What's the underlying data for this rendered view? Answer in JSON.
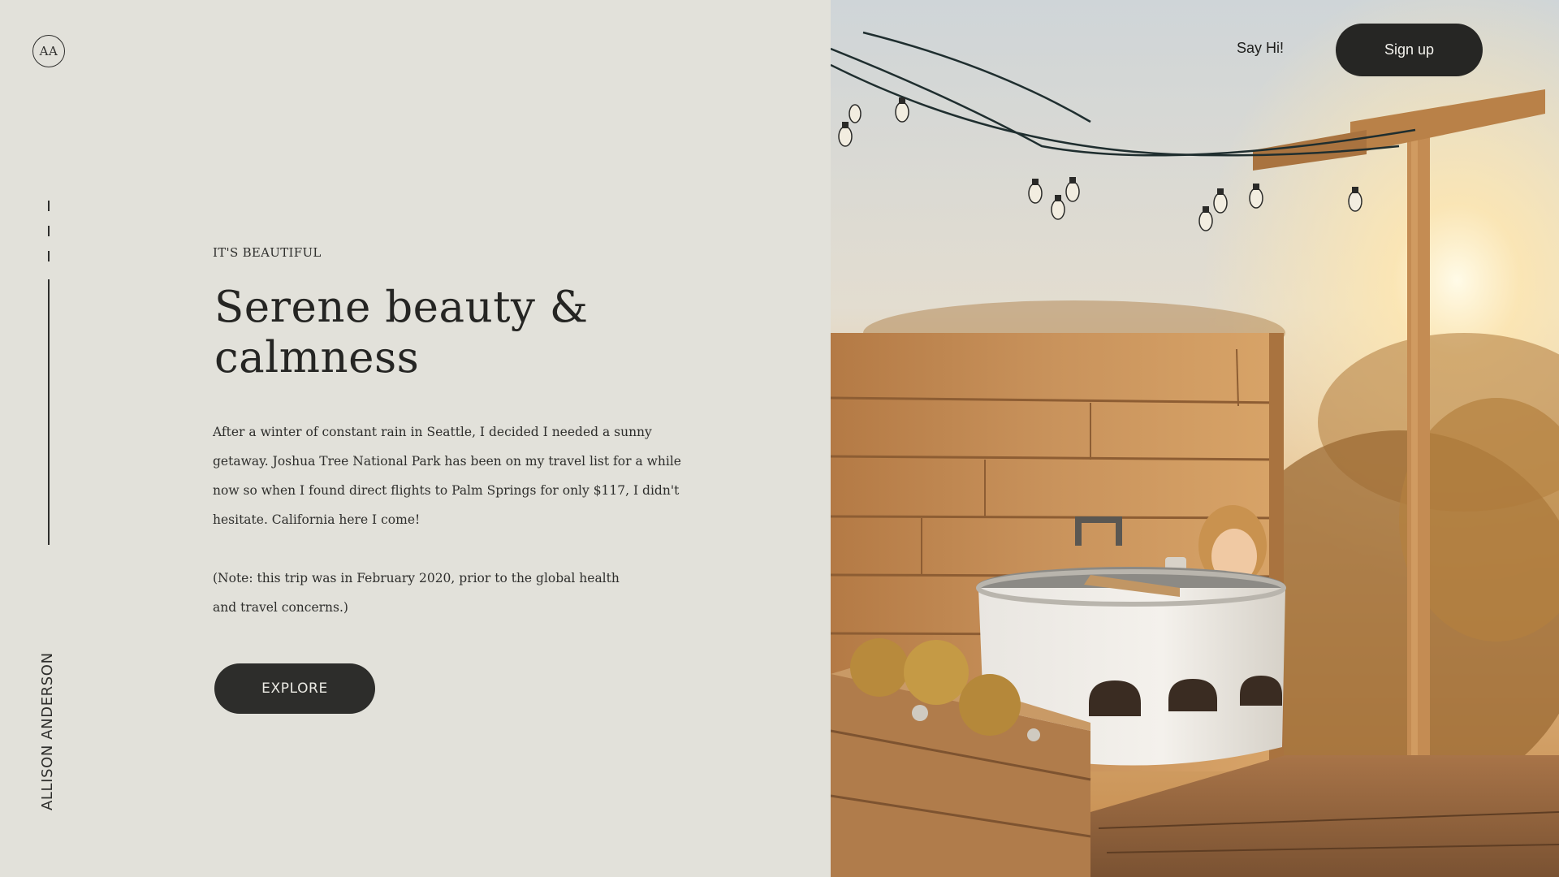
{
  "brand": {
    "logo_text": "AA",
    "author_name": "ALLISON ANDERSON"
  },
  "nav": {
    "say_hi_label": "Say Hi!",
    "signup_label": "Sign up"
  },
  "hero": {
    "eyebrow": "IT'S BEAUTIFUL",
    "title": "Serene beauty & calmness",
    "paragraph_1": "After a winter of constant rain in Seattle, I decided I needed a sunny getaway. Joshua Tree National Park has been on my travel list for a while now so when I found direct flights to Palm Springs for only $117, I didn't hesitate. California here I come!",
    "paragraph_2": "(Note: this trip was in February 2020, prior to the global health and travel concerns.)",
    "cta_label": "EXPLORE"
  },
  "slider": {
    "slide_count": 4,
    "active_index": 4
  },
  "colors": {
    "background": "#e2e1da",
    "dark": "#2d2d2b",
    "button_text": "#ecebe5"
  }
}
